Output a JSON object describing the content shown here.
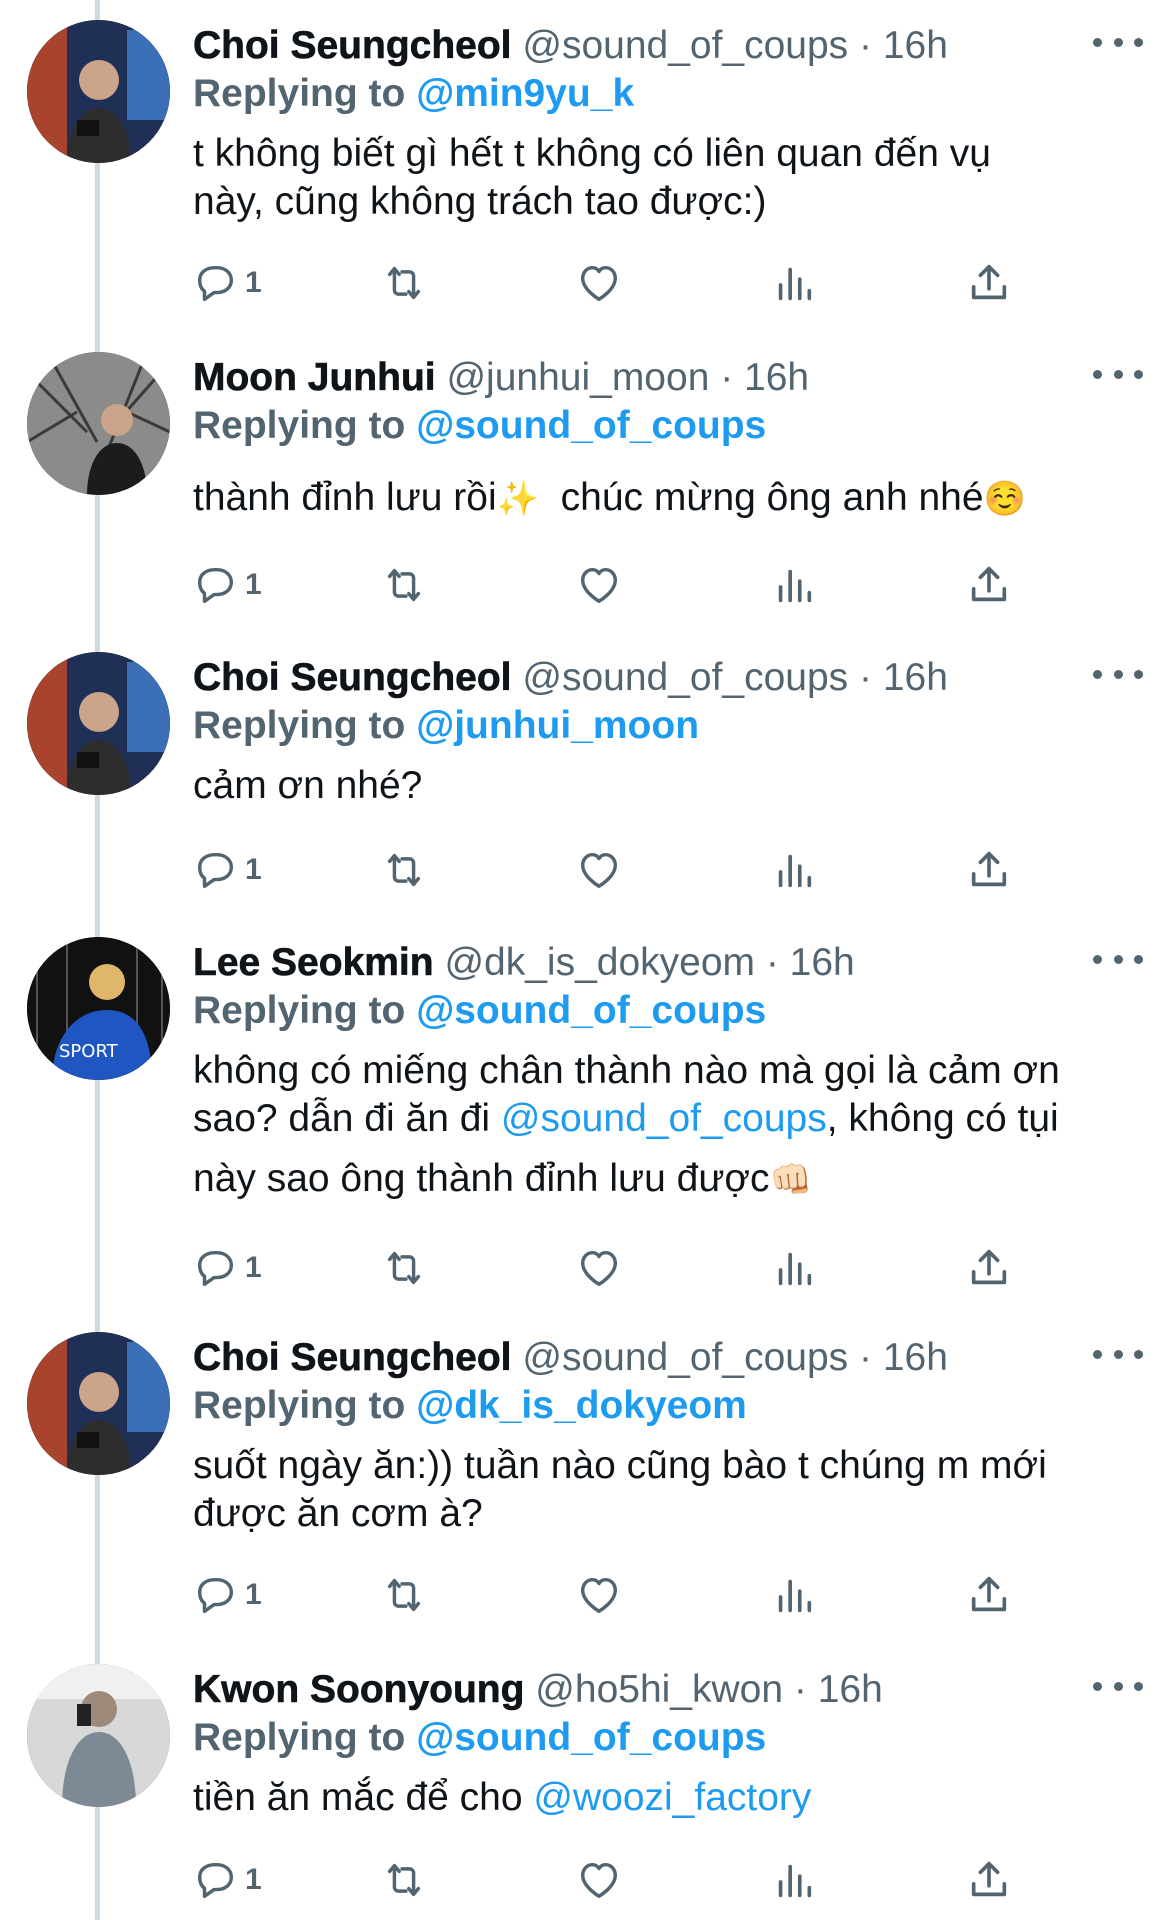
{
  "colors": {
    "accent": "#1d9bf0",
    "text": "#0f1419",
    "muted": "#536471",
    "thread_line": "#cfd9de"
  },
  "icons": [
    "reply-icon",
    "retweet-icon",
    "like-icon",
    "views-icon",
    "share-icon",
    "more-icon"
  ],
  "tweets": [
    {
      "name": "Choi Seungcheol",
      "handle": "@sound_of_coups",
      "time": "· 16h",
      "replying_label": "Replying to",
      "replying_to": "@min9yu_k",
      "text_lines": [
        "t không biết gì hết t không có liên quan đến vụ",
        "này, cũng không trách tao được:)"
      ],
      "reply_count": "1"
    },
    {
      "name": "Moon Junhui",
      "handle": "@junhui_moon",
      "time": "· 16h",
      "replying_label": "Replying to",
      "replying_to": "@sound_of_coups",
      "text": "thành đỉnh lưu rồi",
      "emoji1": "✨",
      "text2": "  chúc mừng ông anh nhé",
      "emoji2": "☺️",
      "reply_count": "1"
    },
    {
      "name": "Choi Seungcheol",
      "handle": "@sound_of_coups",
      "time": "· 16h",
      "replying_label": "Replying to",
      "replying_to": "@junhui_moon",
      "text": "cảm ơn nhé?",
      "reply_count": "1"
    },
    {
      "name": "Lee Seokmin",
      "handle": "@dk_is_dokyeom",
      "time": "· 16h",
      "replying_label": "Replying to",
      "replying_to": "@sound_of_coups",
      "line1": "không có miếng chân thành nào mà gọi là cảm ơn",
      "line2_pre": "sao? dẫn đi ăn đi ",
      "line2_mention": "@sound_of_coups",
      "line2_post": ", không có tụi",
      "line3": "này sao ông thành đỉnh lưu được",
      "line3_emoji": "👊🏻",
      "reply_count": "1"
    },
    {
      "name": "Choi Seungcheol",
      "handle": "@sound_of_coups",
      "time": "· 16h",
      "replying_label": "Replying to",
      "replying_to": "@dk_is_dokyeom",
      "text_lines": [
        "suốt ngày ăn:)) tuần nào cũng bào t chúng m mới",
        "được ăn cơm à?"
      ],
      "reply_count": "1"
    },
    {
      "name": "Kwon Soonyoung",
      "handle": "@ho5hi_kwon",
      "time": "· 16h",
      "replying_label": "Replying to",
      "replying_to": "@sound_of_coups",
      "text_pre": "tiền ăn mắc để cho ",
      "text_mention": "@woozi_factory",
      "reply_count": "1"
    }
  ]
}
